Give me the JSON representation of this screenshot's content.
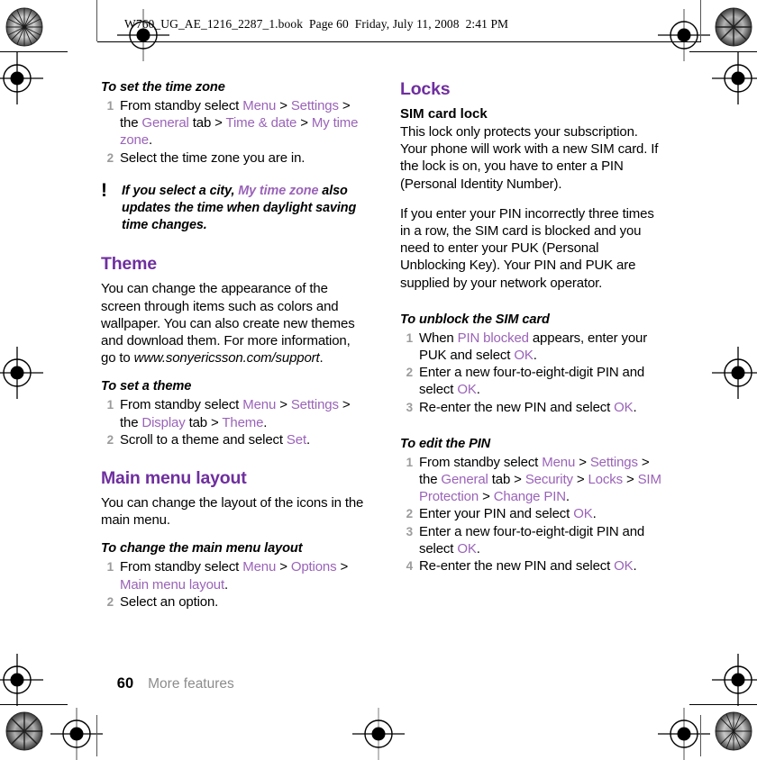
{
  "header": {
    "file_line": "W760_UG_AE_1216_2287_1.book  Page 60  Friday, July 11, 2008  2:41 PM"
  },
  "colors": {
    "heading_purple": "#6f2f9f",
    "link_purple": "#9a63b8",
    "step_number_gray": "#9b9b9b",
    "footer_gray": "#8c8c8c"
  },
  "left_column": {
    "task_time_zone": {
      "title": "To set the time zone",
      "steps": [
        {
          "parts": [
            {
              "t": "From standby select ",
              "s": "plain"
            },
            {
              "t": "Menu",
              "s": "ui"
            },
            {
              "t": " > ",
              "s": "plain"
            },
            {
              "t": "Settings",
              "s": "ui"
            },
            {
              "t": " > the ",
              "s": "plain"
            },
            {
              "t": "General",
              "s": "ui"
            },
            {
              "t": " tab > ",
              "s": "plain"
            },
            {
              "t": "Time & date",
              "s": "ui"
            },
            {
              "t": " > ",
              "s": "plain"
            },
            {
              "t": "My time zone",
              "s": "ui"
            },
            {
              "t": ".",
              "s": "plain"
            }
          ]
        },
        {
          "parts": [
            {
              "t": "Select the time zone you are in.",
              "s": "plain"
            }
          ]
        }
      ]
    },
    "note": {
      "icon": "exclamation-mark",
      "parts": [
        {
          "t": "If you select a city, ",
          "s": "plain"
        },
        {
          "t": "My time zone",
          "s": "ui"
        },
        {
          "t": " also updates the time when daylight saving time changes.",
          "s": "plain"
        }
      ]
    },
    "theme": {
      "heading": "Theme",
      "body_parts": [
        {
          "t": "You can change the appearance of the screen through items such as colors and wallpaper. You can also create new themes and download them. For more information, go to ",
          "s": "plain"
        },
        {
          "t": "www.sonyericsson.com/support",
          "s": "italic"
        },
        {
          "t": ".",
          "s": "plain"
        }
      ],
      "task_title": "To set a theme",
      "steps": [
        {
          "parts": [
            {
              "t": "From standby select ",
              "s": "plain"
            },
            {
              "t": "Menu",
              "s": "ui"
            },
            {
              "t": " > ",
              "s": "plain"
            },
            {
              "t": "Settings",
              "s": "ui"
            },
            {
              "t": " > the ",
              "s": "plain"
            },
            {
              "t": "Display",
              "s": "ui"
            },
            {
              "t": " tab > ",
              "s": "plain"
            },
            {
              "t": "Theme",
              "s": "ui"
            },
            {
              "t": ".",
              "s": "plain"
            }
          ]
        },
        {
          "parts": [
            {
              "t": "Scroll to a theme and select ",
              "s": "plain"
            },
            {
              "t": "Set",
              "s": "ui"
            },
            {
              "t": ".",
              "s": "plain"
            }
          ]
        }
      ]
    },
    "main_menu_layout": {
      "heading": "Main menu layout",
      "body_parts": [
        {
          "t": "You can change the layout of the icons in the main menu.",
          "s": "plain"
        }
      ],
      "task_title": "To change the main menu layout",
      "steps": [
        {
          "parts": [
            {
              "t": "From standby select ",
              "s": "plain"
            },
            {
              "t": "Menu",
              "s": "ui"
            },
            {
              "t": " > ",
              "s": "plain"
            },
            {
              "t": "Options",
              "s": "ui"
            },
            {
              "t": " > ",
              "s": "plain"
            },
            {
              "t": "Main menu layout",
              "s": "ui"
            },
            {
              "t": ".",
              "s": "plain"
            }
          ]
        },
        {
          "parts": [
            {
              "t": "Select an option.",
              "s": "plain"
            }
          ]
        }
      ]
    }
  },
  "right_column": {
    "locks": {
      "heading": "Locks",
      "subheading": "SIM card lock",
      "paragraph_1_parts": [
        {
          "t": "This lock only protects your subscription. Your phone will work with a new SIM card. If the lock is on, you have to enter a PIN (Personal Identity Number).",
          "s": "plain"
        }
      ],
      "paragraph_2_parts": [
        {
          "t": "If you enter your PIN incorrectly three times in a row, the SIM card is blocked and you need to enter your PUK (Personal Unblocking Key). Your PIN and PUK are supplied by your network operator.",
          "s": "plain"
        }
      ]
    },
    "task_unblock_sim": {
      "title": "To unblock the SIM card",
      "steps": [
        {
          "parts": [
            {
              "t": "When ",
              "s": "plain"
            },
            {
              "t": "PIN blocked",
              "s": "ui"
            },
            {
              "t": " appears, enter your PUK and select ",
              "s": "plain"
            },
            {
              "t": "OK",
              "s": "ui"
            },
            {
              "t": ".",
              "s": "plain"
            }
          ]
        },
        {
          "parts": [
            {
              "t": "Enter a new four-to-eight-digit PIN and select ",
              "s": "plain"
            },
            {
              "t": "OK",
              "s": "ui"
            },
            {
              "t": ".",
              "s": "plain"
            }
          ]
        },
        {
          "parts": [
            {
              "t": "Re-enter the new PIN and select ",
              "s": "plain"
            },
            {
              "t": "OK",
              "s": "ui"
            },
            {
              "t": ".",
              "s": "plain"
            }
          ]
        }
      ]
    },
    "task_edit_pin": {
      "title": "To edit the PIN",
      "steps": [
        {
          "parts": [
            {
              "t": "From standby select ",
              "s": "plain"
            },
            {
              "t": "Menu",
              "s": "ui"
            },
            {
              "t": " > ",
              "s": "plain"
            },
            {
              "t": "Settings",
              "s": "ui"
            },
            {
              "t": " > the ",
              "s": "plain"
            },
            {
              "t": "General",
              "s": "ui"
            },
            {
              "t": " tab > ",
              "s": "plain"
            },
            {
              "t": "Security",
              "s": "ui"
            },
            {
              "t": " > ",
              "s": "plain"
            },
            {
              "t": "Locks",
              "s": "ui"
            },
            {
              "t": " > ",
              "s": "plain"
            },
            {
              "t": "SIM Protection",
              "s": "ui"
            },
            {
              "t": " > ",
              "s": "plain"
            },
            {
              "t": "Change PIN",
              "s": "ui"
            },
            {
              "t": ".",
              "s": "plain"
            }
          ]
        },
        {
          "parts": [
            {
              "t": "Enter your PIN and select ",
              "s": "plain"
            },
            {
              "t": "OK",
              "s": "ui"
            },
            {
              "t": ".",
              "s": "plain"
            }
          ]
        },
        {
          "parts": [
            {
              "t": "Enter a new four-to-eight-digit PIN and select ",
              "s": "plain"
            },
            {
              "t": "OK",
              "s": "ui"
            },
            {
              "t": ".",
              "s": "plain"
            }
          ]
        },
        {
          "parts": [
            {
              "t": "Re-enter the new PIN and select ",
              "s": "plain"
            },
            {
              "t": "OK",
              "s": "ui"
            },
            {
              "t": ".",
              "s": "plain"
            }
          ]
        }
      ]
    }
  },
  "footer": {
    "page_number": "60",
    "section": "More features"
  }
}
